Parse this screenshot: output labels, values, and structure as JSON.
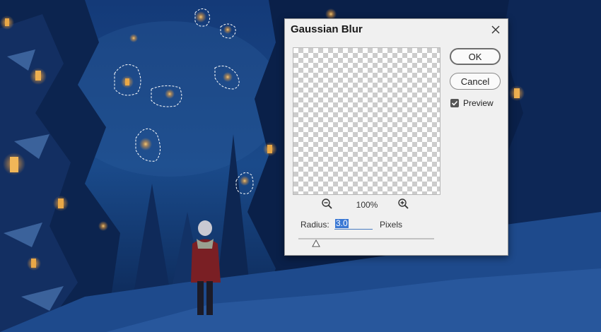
{
  "dialog": {
    "title": "Gaussian Blur",
    "zoom_level": "100%",
    "buttons": {
      "ok": "OK",
      "cancel": "Cancel"
    },
    "preview": {
      "label": "Preview",
      "checked": true
    },
    "radius": {
      "label": "Radius:",
      "value": "3.0",
      "unit": "Pixels"
    },
    "slider": {
      "value_fraction": 0.13
    }
  },
  "icons": {
    "close": "close-icon",
    "zoom_out": "zoom-out-icon",
    "zoom_in": "zoom-in-icon",
    "check": "checkmark-icon"
  },
  "colors": {
    "night_sky": "#0e2a5c",
    "lantern_glow": "#f2b654",
    "selection_highlight": "#3a78d4"
  }
}
